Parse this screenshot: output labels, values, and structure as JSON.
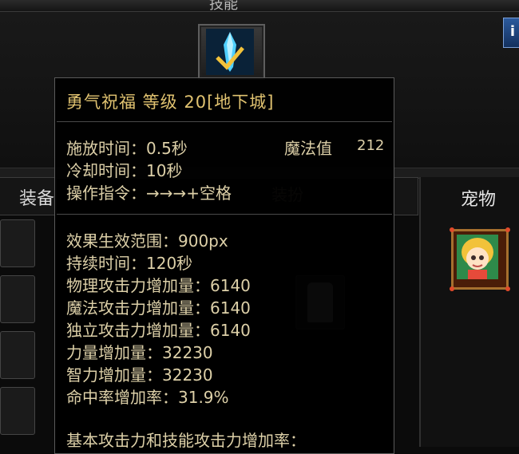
{
  "header": {
    "title": "技能",
    "info_icon": "info-icon"
  },
  "skill_icon": {
    "icon": "sword-icon"
  },
  "background": {
    "equip_tab": "装备",
    "costume_text": "装扮",
    "pet_label": "宠物"
  },
  "tooltip": {
    "title": "勇气祝福 等级 20[地下城]",
    "cast_time": "施放时间：0.5秒",
    "cooldown": "冷却时间：10秒",
    "command": "操作指令：→→→+空格",
    "mp_label": "魔法值",
    "mp_value": "212",
    "effects": [
      "效果生效范围：900px",
      "持续时间：120秒",
      "物理攻击力增加量：6140",
      "魔法攻击力增加量：6140",
      "独立攻击力增加量：6140",
      "力量增加量：32230",
      "智力增加量：32230",
      "命中率增加率：31.9%",
      "基本攻击力和技能攻击力增加率："
    ]
  },
  "colors": {
    "tooltip_title": "#e0c270",
    "tooltip_text": "#ddd0a8",
    "panel_bg": "#0b0b0b"
  }
}
